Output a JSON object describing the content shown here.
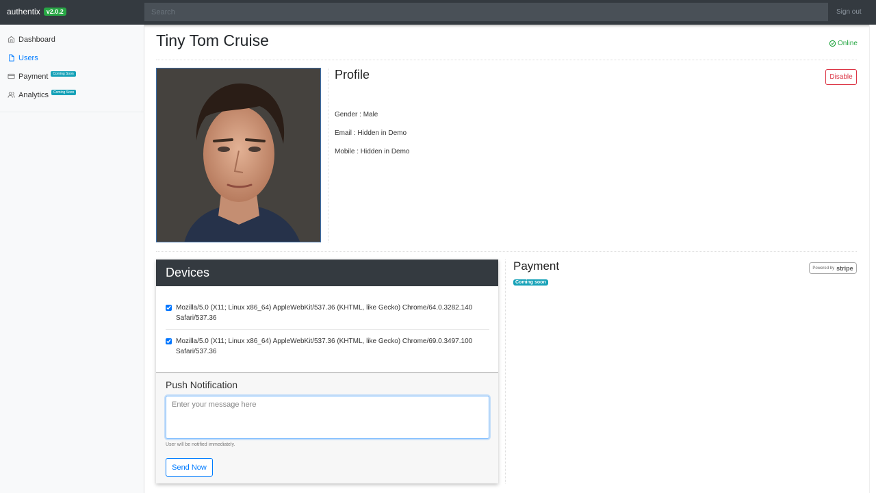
{
  "navbar": {
    "brand": "authentix",
    "version": "v2.0.2",
    "search_placeholder": "Search",
    "signout": "Sign out"
  },
  "sidebar": {
    "items": [
      {
        "label": "Dashboard",
        "icon": "home-icon",
        "active": false
      },
      {
        "label": "Users",
        "icon": "file-icon",
        "active": true
      },
      {
        "label": "Payment",
        "icon": "credit-card-icon",
        "badge": "Coming Soon"
      },
      {
        "label": "Analytics",
        "icon": "users-icon",
        "badge": "Coming Soon"
      }
    ]
  },
  "user": {
    "name": "Tiny Tom Cruise",
    "status": "Online",
    "status_color": "#28a745"
  },
  "profile": {
    "title": "Profile",
    "disable_label": "Disable",
    "gender": "Gender : Male",
    "email": "Email : Hidden in Demo",
    "mobile": "Mobile : Hidden in Demo"
  },
  "devices": {
    "title": "Devices",
    "items": [
      {
        "agent": "Mozilla/5.0 (X11; Linux x86_64) AppleWebKit/537.36 (KHTML, like Gecko) Chrome/64.0.3282.140 Safari/537.36",
        "checked": true
      },
      {
        "agent": "Mozilla/5.0 (X11; Linux x86_64) AppleWebKit/537.36 (KHTML, like Gecko) Chrome/69.0.3497.100 Safari/537.36",
        "checked": true
      }
    ]
  },
  "push": {
    "title": "Push Notification",
    "placeholder": "Enter your message here",
    "value": "",
    "help": "User will be notified immediately.",
    "send_label": "Send Now"
  },
  "payment": {
    "title": "Payment",
    "badge": "Coming soon",
    "powered_by": "Powered by",
    "stripe": "stripe"
  },
  "colors": {
    "navbar": "#343a40",
    "brand_badge": "#28a745",
    "primary": "#007bff",
    "danger": "#dc3545",
    "info_badge": "#17a2b8"
  }
}
